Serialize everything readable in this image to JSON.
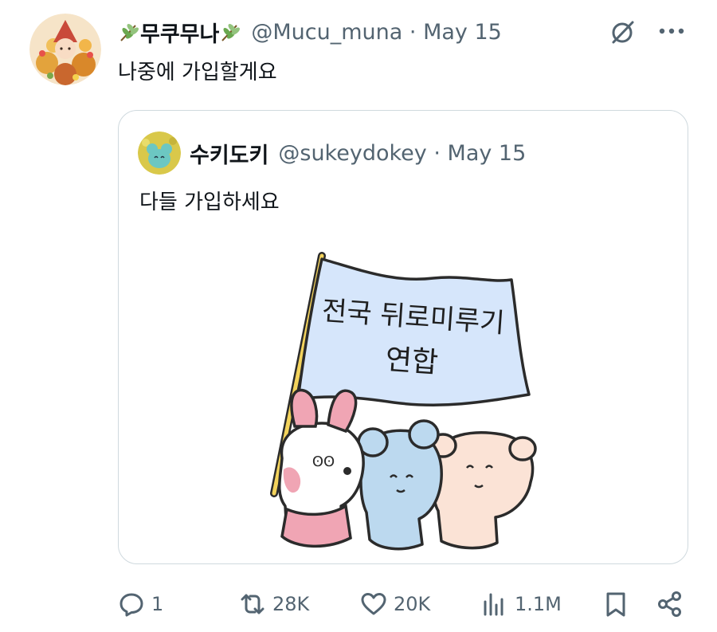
{
  "tweet": {
    "author": {
      "display_name": "무쿠무나",
      "handle": "@Mucu_muna",
      "date": "May 15",
      "separator": "·",
      "avatar_icon": "avatar-image"
    },
    "text": "나중에 가입할게요",
    "quoted": {
      "author": {
        "display_name": "수키도키",
        "handle": "@sukeydokey",
        "date": "May 15",
        "separator": "·",
        "avatar_icon": "avatar-image"
      },
      "text": "다들 가입하세요",
      "image": {
        "flag_line_1": "전국 뒤로미루기",
        "flag_line_2": "연합",
        "bunny_face": "ʘʘ"
      }
    },
    "actions": {
      "replies": "1",
      "reposts": "28K",
      "likes": "20K",
      "views": "1.1M"
    }
  },
  "colors": {
    "text_primary": "#0f1419",
    "text_secondary": "#536471",
    "border": "#cfd9de",
    "flag": "#d6e6fb",
    "pink": "#f0a5b4",
    "blue": "#bcd9ef",
    "peach": "#fbe3d6"
  }
}
